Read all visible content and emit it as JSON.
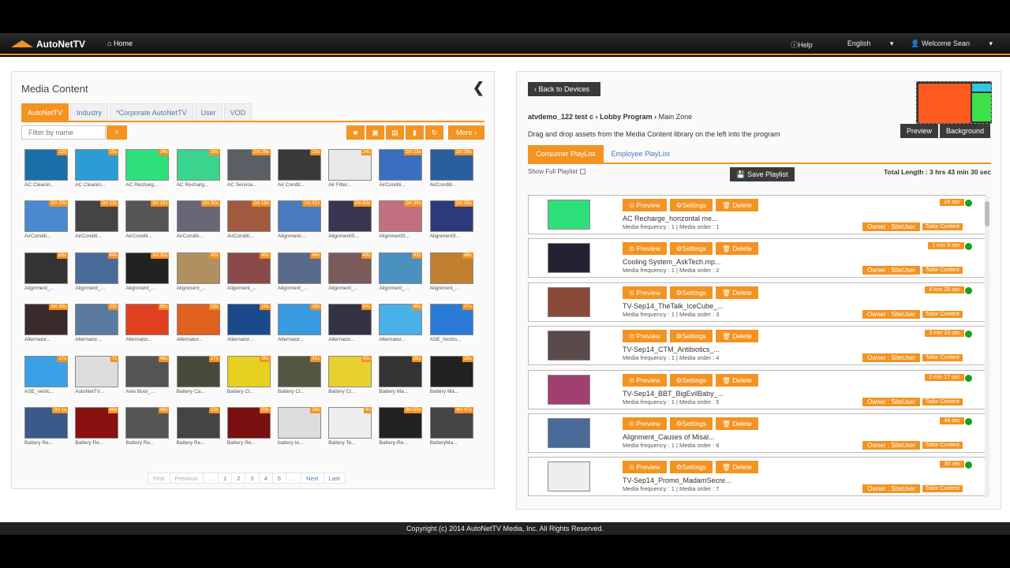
{
  "nav": {
    "brand": "AutoNetTV",
    "home": "Home",
    "help": "Help",
    "language": "English",
    "welcome": "Welcome Sean"
  },
  "left": {
    "title": "Media Content",
    "tabs": [
      "AutoNetTV",
      "Industry",
      "*Corporate AutoNetTV",
      "User",
      "VOD"
    ],
    "filter_placeholder": "Filter by name",
    "more": "More",
    "thumbs": [
      {
        "d": "13s",
        "c": "AC Cleanin...",
        "col": "#1a6fa8"
      },
      {
        "d": "15s",
        "c": "AC Cleanin...",
        "col": "#2c9cd4"
      },
      {
        "d": "24s",
        "c": "AC Recharg...",
        "col": "#2ee07a"
      },
      {
        "d": "26s",
        "c": "AC Recharg...",
        "col": "#3bd48f"
      },
      {
        "d": "2m 26s",
        "c": "AC Service...",
        "col": "#5a5f66"
      },
      {
        "d": "15s",
        "c": "Air Condit...",
        "col": "#3a3a3a"
      },
      {
        "d": "24s",
        "c": "Air Filter...",
        "col": "#e8e8e8"
      },
      {
        "d": "2m 23s",
        "c": "AirConditi...",
        "col": "#3a6fbf"
      },
      {
        "d": "2m 26s",
        "c": "AirConditi...",
        "col": "#2a5f9f"
      },
      {
        "d": "2m 20s",
        "c": "AirConditi...",
        "col": "#4a88d0"
      },
      {
        "d": "2m 12s",
        "c": "AirConditi...",
        "col": "#444"
      },
      {
        "d": "2m 12s",
        "c": "AirConditi...",
        "col": "#555"
      },
      {
        "d": "2m 30s",
        "c": "AirConditi...",
        "col": "#667"
      },
      {
        "d": "2m 18s",
        "c": "AirConditi...",
        "col": "#a05a40"
      },
      {
        "d": "1m 42s",
        "c": "Alignment-...",
        "col": "#4a7ac0"
      },
      {
        "d": "2m 42s",
        "c": "AlignmentS...",
        "col": "#3a3550"
      },
      {
        "d": "2m 34s",
        "c": "AlignmentS...",
        "col": "#c07080"
      },
      {
        "d": "2m 35s",
        "c": "AlignmentS...",
        "col": "#2a3a7a"
      },
      {
        "d": "63s",
        "c": "Alignment_...",
        "col": "#333"
      },
      {
        "d": "44s",
        "c": "Alignment_...",
        "col": "#4a6a9a"
      },
      {
        "d": "1m 30s",
        "c": "Alignment_...",
        "col": "#222"
      },
      {
        "d": "43s",
        "c": "Alignment_...",
        "col": "#b09060"
      },
      {
        "d": "45s",
        "c": "Alignment_...",
        "col": "#8a4a4a"
      },
      {
        "d": "46s",
        "c": "Alignment_...",
        "col": "#5a6a8a"
      },
      {
        "d": "40s",
        "c": "Alignment_...",
        "col": "#7a5a5a"
      },
      {
        "d": "43s",
        "c": "Alignment_...",
        "col": "#4a90c0"
      },
      {
        "d": "46s",
        "c": "Alignment_...",
        "col": "#c08030"
      },
      {
        "d": "4m 38s",
        "c": "Alternator...",
        "col": "#3a2a2a"
      },
      {
        "d": "33s",
        "c": "Alternator...",
        "col": "#5a7aa0"
      },
      {
        "d": "56s",
        "c": "Alternator...",
        "col": "#e04020"
      },
      {
        "d": "18s",
        "c": "Alternator...",
        "col": "#e06020"
      },
      {
        "d": "16s",
        "c": "Alternator...",
        "col": "#1a4a8a"
      },
      {
        "d": "16s",
        "c": "Alternator...",
        "col": "#3a9ae0"
      },
      {
        "d": "34s",
        "c": "Alternator...",
        "col": "#334"
      },
      {
        "d": "46s",
        "c": "Alternator...",
        "col": "#4ab0e8"
      },
      {
        "d": "47s",
        "c": "ASE_horizo...",
        "col": "#2a7ad8"
      },
      {
        "d": "17s",
        "c": "ASE_vertic...",
        "col": "#3aa0e8"
      },
      {
        "d": "7s",
        "c": "AutoNetTV...",
        "col": "#ddd"
      },
      {
        "d": "46s",
        "c": "Axle Boot_...",
        "col": "#555"
      },
      {
        "d": "27s",
        "c": "Battery Ca...",
        "col": "#4a4a3a"
      },
      {
        "d": "36s",
        "c": "Battery Cl...",
        "col": "#e8d020"
      },
      {
        "d": "41s",
        "c": "Battery Cl...",
        "col": "#554"
      },
      {
        "d": "42s",
        "c": "Battery Cl...",
        "col": "#e8d030"
      },
      {
        "d": "28s",
        "c": "Battery Ma...",
        "col": "#333"
      },
      {
        "d": "28s",
        "c": "Battery Ma...",
        "col": "#222"
      },
      {
        "d": "2m 1s",
        "c": "Battery Re...",
        "col": "#3a5a8a"
      },
      {
        "d": "46s",
        "c": "Battery Re...",
        "col": "#8a1010"
      },
      {
        "d": "46s",
        "c": "Battery Re...",
        "col": "#555"
      },
      {
        "d": "13s",
        "c": "Battery Re...",
        "col": "#444"
      },
      {
        "d": "53s",
        "c": "Battery Re...",
        "col": "#7a1010"
      },
      {
        "d": "16s",
        "c": "battery te...",
        "col": "#ddd"
      },
      {
        "d": "4s",
        "c": "Battery Te...",
        "col": "#eee"
      },
      {
        "d": "3m 53s",
        "c": "Battery-Re...",
        "col": "#222"
      },
      {
        "d": "4m 47s",
        "c": "BatteryMa...",
        "col": "#444"
      }
    ],
    "pager": [
      "First",
      "Previous",
      "...",
      "1",
      "2",
      "3",
      "4",
      "5",
      "...",
      "Next",
      "Last"
    ]
  },
  "right": {
    "back": "Back to Devices",
    "preview": "Preview",
    "background": "Background",
    "crumb": {
      "device": "atvdemo_122 test c",
      "program": "Lobby Program",
      "zone": "Main Zone"
    },
    "instructions": "Drag and drop assets from the Media Content library on the left into the program",
    "tabs": [
      "Consumer PlayList",
      "Employee PlayList"
    ],
    "show_full": "Show Full Playlist",
    "save": "Save Playlist",
    "total": "Total Length : 3 hrs 43 min 30 sec",
    "btn_preview": "Preview",
    "btn_settings": "Settings",
    "btn_delete": "Delete",
    "owner": "Owner : SiteUser",
    "tailored": "Tailor Content",
    "items": [
      {
        "name": "AC Recharge_horizontal me...",
        "meta": "Media frequency : 1 | Media order : 1",
        "dur": "24 sec",
        "col": "#2ee07a"
      },
      {
        "name": "Cooling System_AskTech.mp...",
        "meta": "Media frequency : 1 | Media order : 2",
        "dur": "1 min 9 sec",
        "col": "#223"
      },
      {
        "name": "TV-Sep14_TheTalk_IceCube_...",
        "meta": "Media frequency : 1 | Media order : 3",
        "dur": "4 min 28 sec",
        "col": "#8a4a3a"
      },
      {
        "name": "TV-Sep14_CTM_Antibiotics_...",
        "meta": "Media frequency : 1 | Media order : 4",
        "dur": "3 min 23 sec",
        "col": "#5a4a4a"
      },
      {
        "name": "TV-Sep14_BBT_BigEvilBaby_...",
        "meta": "Media frequency : 1 | Media order : 5",
        "dur": "2 min 17 sec",
        "col": "#a04070"
      },
      {
        "name": "Alignment_Causes of Misal...",
        "meta": "Media frequency : 1 | Media order : 6",
        "dur": "44 sec",
        "col": "#4a6a9a"
      },
      {
        "name": "TV-Sep14_Promo_MadamSecre...",
        "meta": "Media frequency : 1 | Media order : 7",
        "dur": "30 sec",
        "col": "#eee"
      }
    ]
  },
  "footer": "Copyright (c) 2014 AutoNetTV Media, Inc. All Rights Reserved."
}
